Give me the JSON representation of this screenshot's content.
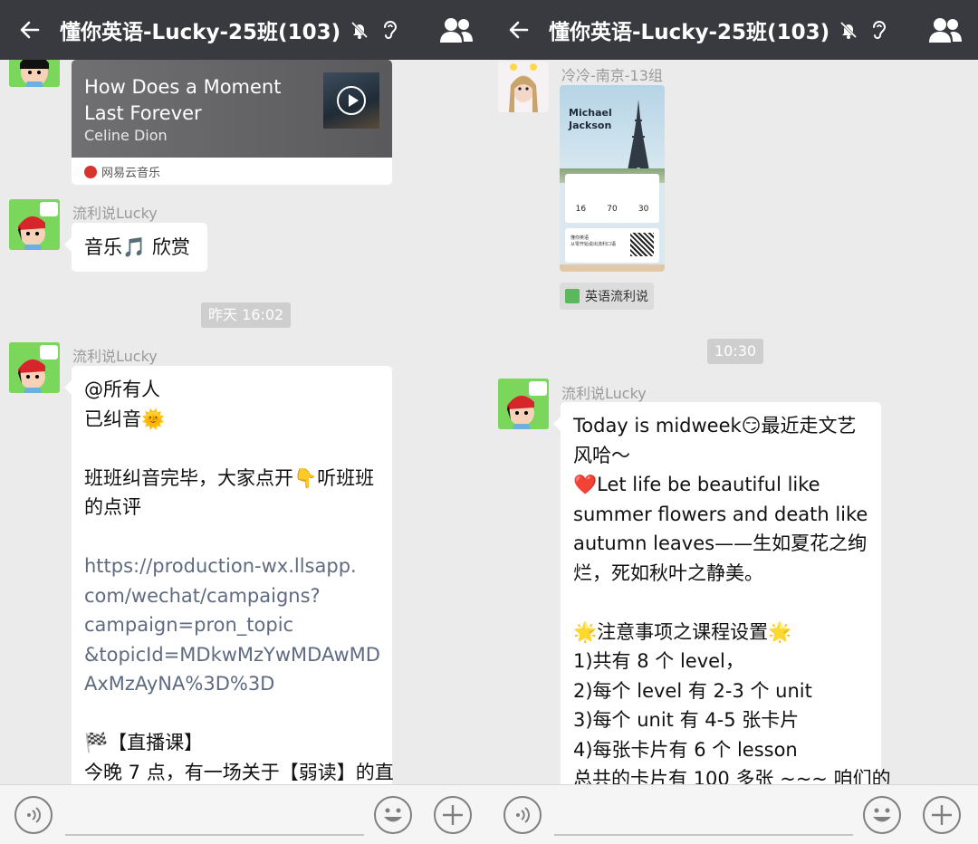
{
  "panes": [
    {
      "header": {
        "back_icon": "arrow-left-icon",
        "title": "懂你英语-Lucky-25班(103)",
        "mute_icon": "bell-off-icon",
        "ear_icon": "ear-icon",
        "members_icon": "people-icon"
      },
      "messages": {
        "music": {
          "title_line1": "How Does a Moment",
          "title_line2": "Last Forever",
          "artist": "Celine Dion",
          "source": "网易云音乐"
        },
        "msg2": {
          "sender": "流利说Lucky",
          "text": "音乐🎵 欣赏"
        },
        "time1": "昨天 16:02",
        "msg3": {
          "sender": "流利说Lucky",
          "lines": [
            "@所有人",
            "已纠音🌞",
            "",
            "班班纠音完毕，大家点开👇听班班",
            "的点评",
            "",
            "https://production-wx.llsapp.",
            "com/wechat/campaigns?",
            "campaign=pron_topic",
            "&topicId=MDkwMzYwMDAwMD",
            "AxMzAyNA%3D%3D",
            "",
            "🏁【直播课】",
            "今晚 7 点，有一场关于【弱读】的直"
          ]
        }
      }
    },
    {
      "header": {
        "back_icon": "arrow-left-icon",
        "title": "懂你英语-Lucky-25班(103)",
        "mute_icon": "bell-off-icon",
        "ear_icon": "ear-icon",
        "members_icon": "people-icon"
      },
      "messages": {
        "poster_msg": {
          "sender": "冷冷-南京-13组",
          "poster_heading_1": "Michael",
          "poster_heading_2": "Jackson",
          "poster_num_1": "16",
          "poster_num_2": "70",
          "poster_num_3": "30",
          "poster_card_text_1": "懂你英语",
          "poster_card_text_2": "从零开始说出流利口语",
          "source_tag": "英语流利说"
        },
        "time2": "10:30",
        "msg4": {
          "sender": "流利说Lucky",
          "lines": [
            "Today  is  midweek😏最近走文艺",
            "风哈～",
            "❤️Let life be beautiful like",
            "summer flowers and death like",
            "autumn leaves——生如夏花之绚",
            "烂，死如秋叶之静美。",
            "",
            "🌟注意事项之课程设置🌟",
            "1)共有 8 个 level，",
            "2)每个 level 有 2-3 个 unit",
            "3)每个 unit 有 4-5 张卡片",
            "4)每张卡片有 6 个 lesson",
            "总共的卡片有 100 多张 ~~~ 咱们的"
          ]
        }
      }
    }
  ],
  "input_bar": {
    "voice_icon": "voice-icon",
    "emoji_icon": "emoji-icon",
    "plus_icon": "plus-icon"
  }
}
